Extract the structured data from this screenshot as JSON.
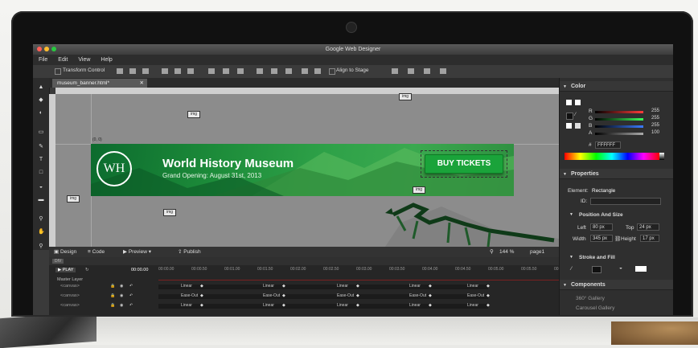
{
  "window": {
    "title": "Google Web Designer"
  },
  "menu": [
    "File",
    "Edit",
    "View",
    "Help"
  ],
  "toolbar": {
    "transform_label": "Transform Control",
    "align_label": "Align to Stage"
  },
  "doc_tab": {
    "label": "museum_banner.html*"
  },
  "canvas": {
    "img_tag": "img",
    "coord_label": "(0, 0)"
  },
  "banner": {
    "logo_text": "WH",
    "title": "World History Museum",
    "subtitle": "Grand Opening: August 31st, 2013",
    "button_label": "BUY TICKETS",
    "accent": "#1aa33a"
  },
  "statusbar": {
    "design": "Design",
    "code": "Code",
    "preview": "Preview",
    "publish": "Publish",
    "zoom": "144",
    "zoom_unit": "%",
    "page": "page1"
  },
  "timeline": {
    "element_tag": "DIV",
    "play_label": "PLAY",
    "time": "00:00.00",
    "master_label": "Master Layer",
    "ticks": [
      "00:00.00",
      "00:00.50",
      "00:01.00",
      "00:01.50",
      "00:02.00",
      "00:02.50",
      "00:03.00",
      "00:03.50",
      "00:04.00",
      "00:04.50",
      "00:05.00",
      "00:05.50",
      "00:06.00"
    ],
    "rows": [
      {
        "label": "<canvas>",
        "easings": [
          "Linear",
          "Linear",
          "Linear",
          "Linear",
          "Linear"
        ]
      },
      {
        "label": "<canvas>",
        "easings": [
          "Ease-Out",
          "Ease-Out",
          "Ease-Out",
          "Ease-Out",
          "Ease-Out"
        ]
      },
      {
        "label": "<canvas>",
        "easings": [
          "Linear",
          "Linear",
          "Linear",
          "Linear",
          "Linear"
        ]
      }
    ]
  },
  "color_panel": {
    "title": "Color",
    "channels": [
      {
        "name": "R",
        "value": "255",
        "color": "#ff3b3b"
      },
      {
        "name": "G",
        "value": "255",
        "color": "#3bff5a"
      },
      {
        "name": "B",
        "value": "255",
        "color": "#3b7bff"
      },
      {
        "name": "A",
        "value": "100",
        "color": "#aaaaaa"
      }
    ],
    "hash": "#",
    "hex": "FFFFFF"
  },
  "properties": {
    "title": "Properties",
    "element_label": "Element:",
    "element_value": "Rectangle",
    "id_label": "ID:",
    "pos_title": "Position And Size",
    "left_label": "Left",
    "left_value": "80",
    "left_unit": "px",
    "top_label": "Top",
    "top_value": "24",
    "top_unit": "px",
    "width_label": "Width",
    "width_value": "345",
    "width_unit": "px",
    "height_label": "Height",
    "height_value": "17",
    "height_unit": "px",
    "stroke_title": "Stroke and Fill"
  },
  "components": {
    "title": "Components",
    "items": [
      "360° Gallery",
      "Carousel Gallery"
    ]
  }
}
